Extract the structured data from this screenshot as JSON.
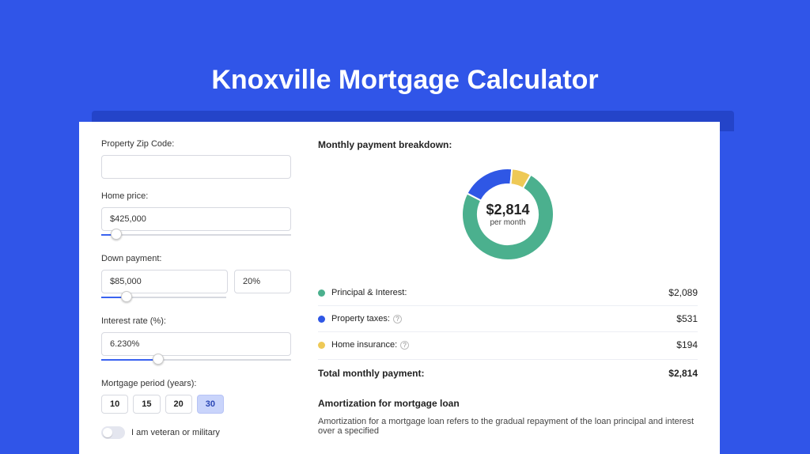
{
  "title": "Knoxville Mortgage Calculator",
  "left": {
    "zip_label": "Property Zip Code:",
    "zip_value": "",
    "home_price_label": "Home price:",
    "home_price_value": "$425,000",
    "home_slider_pct": 8,
    "down_label": "Down payment:",
    "down_value": "$85,000",
    "down_pct_value": "20%",
    "down_slider_pct": 20,
    "rate_label": "Interest rate (%):",
    "rate_value": "6.230%",
    "rate_slider_pct": 30,
    "period_label": "Mortgage period (years):",
    "periods": [
      "10",
      "15",
      "20",
      "30"
    ],
    "period_selected": "30",
    "veteran_label": "I am veteran or military",
    "veteran_on": false
  },
  "right": {
    "breakdown_title": "Monthly payment breakdown:",
    "amount": "$2,814",
    "per_month": "per month",
    "rows": [
      {
        "label": "Principal & Interest:",
        "value": "$2,089",
        "color": "#4bb08e",
        "info": false
      },
      {
        "label": "Property taxes:",
        "value": "$531",
        "color": "#2f57e5",
        "info": true
      },
      {
        "label": "Home insurance:",
        "value": "$194",
        "color": "#eec956",
        "info": true
      }
    ],
    "total_label": "Total monthly payment:",
    "total_value": "$2,814",
    "amort_title": "Amortization for mortgage loan",
    "amort_text": "Amortization for a mortgage loan refers to the gradual repayment of the loan principal and interest over a specified"
  },
  "chart_data": {
    "type": "pie",
    "title": "Monthly payment breakdown",
    "series": [
      {
        "name": "Principal & Interest",
        "value": 2089,
        "color": "#4bb08e"
      },
      {
        "name": "Property taxes",
        "value": 531,
        "color": "#2f57e5"
      },
      {
        "name": "Home insurance",
        "value": 194,
        "color": "#eec956"
      }
    ],
    "total": 2814,
    "center_label": "$2,814 per month",
    "donut": true
  }
}
